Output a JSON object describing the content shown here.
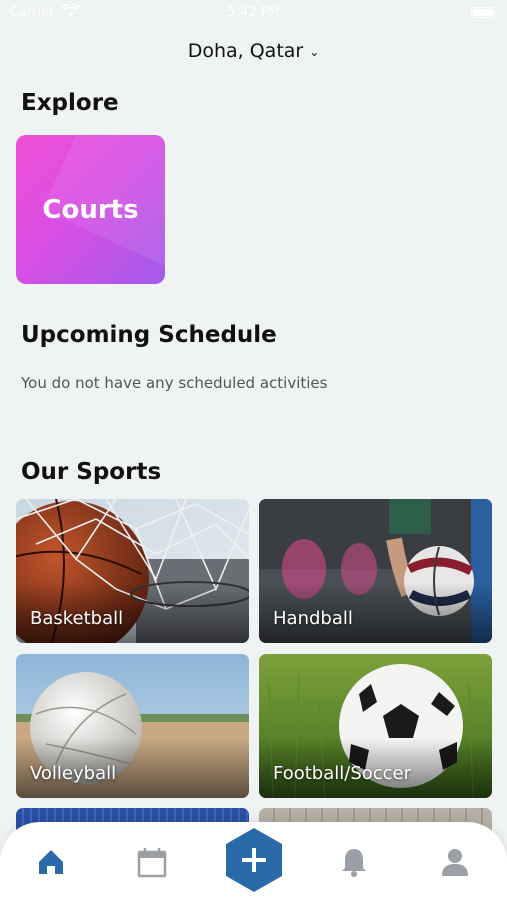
{
  "status_bar": {
    "carrier": "Carrier",
    "time": "5:42 PM"
  },
  "header": {
    "location": "Doha, Qatar",
    "chevron": "chevron-down-icon"
  },
  "explore": {
    "title": "Explore",
    "card_label": "Courts"
  },
  "schedule": {
    "title": "Upcoming Schedule",
    "empty_message": "You do not have any scheduled activities"
  },
  "sports": {
    "title": "Our Sports",
    "items": [
      {
        "label": "Basketball"
      },
      {
        "label": "Handball"
      },
      {
        "label": "Volleyball"
      },
      {
        "label": "Football/Soccer"
      }
    ]
  },
  "bottom_nav": {
    "active_color": "#2a6aa8",
    "inactive_color": "#9aa0a6",
    "items": [
      {
        "icon": "home-icon",
        "active": true
      },
      {
        "icon": "calendar-icon",
        "active": false
      },
      {
        "icon": "add-icon",
        "active": false
      },
      {
        "icon": "bell-icon",
        "active": false
      },
      {
        "icon": "user-icon",
        "active": false
      }
    ]
  },
  "colors": {
    "background": "#eff3f3",
    "accent": "#2a6aa8",
    "courts_gradient_start": "#ee4fd5",
    "courts_gradient_end": "#a25be9"
  }
}
